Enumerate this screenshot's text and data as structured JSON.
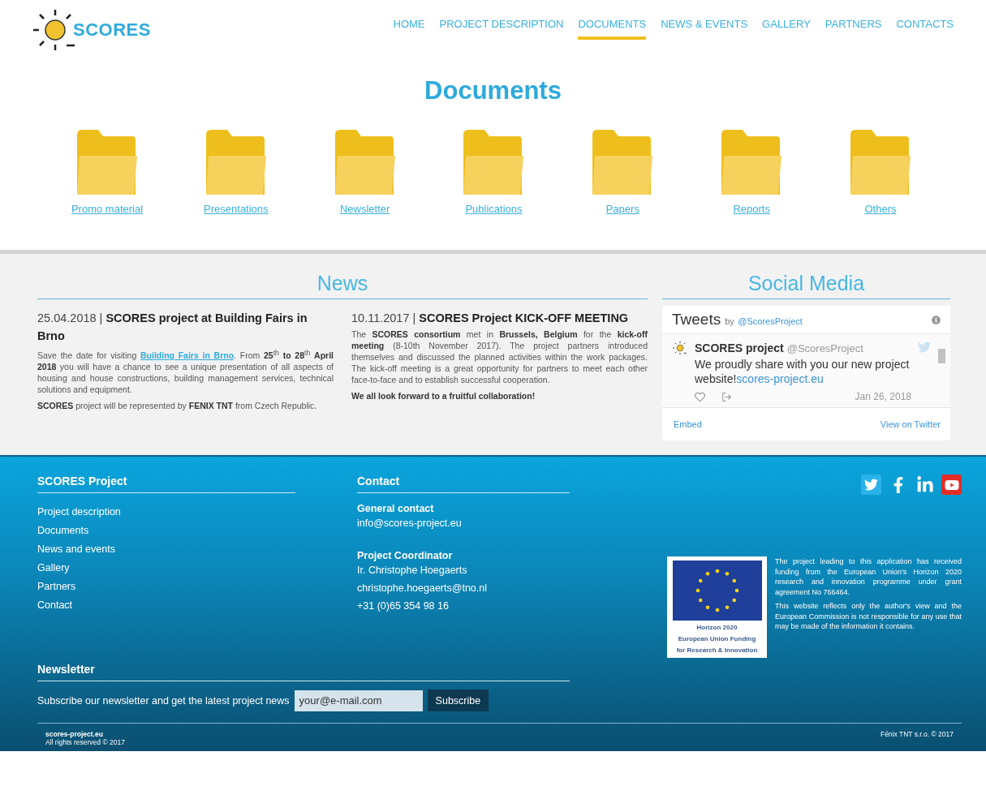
{
  "header": {
    "logo_text": "SCORES",
    "nav": [
      {
        "label": "HOME",
        "selected": false
      },
      {
        "label": "PROJECT DESCRIPTION",
        "selected": false
      },
      {
        "label": "DOCUMENTS",
        "selected": true
      },
      {
        "label": "NEWS & EVENTS",
        "selected": false
      },
      {
        "label": "GALLERY",
        "selected": false
      },
      {
        "label": "PARTNERS",
        "selected": false
      },
      {
        "label": "CONTACTS",
        "selected": false
      }
    ]
  },
  "documents": {
    "title": "Documents",
    "folders": [
      "Promo material",
      "Presentations",
      "Newsletter",
      "Publications",
      "Papers",
      "Reports",
      "Others"
    ]
  },
  "news": {
    "title": "News",
    "items": [
      {
        "heading": "25.04.2018 | **SCORES project at Building Fairs in Brno**",
        "paragraphs": [
          {
            "before": "Save the date for visiting ",
            "link": "Building Fairs in Brno",
            "after": ". From **25**$^{th}$ **to 28**$^{th}$ **April 2018** you will have a chance to see a unique presentation of all aspects of housing and house constructions, building management services, technical solutions and equipment."
          },
          {
            "before": "**SCORES** project will be represented by **FENIX TNT** from Czech Republic."
          }
        ]
      },
      {
        "heading": "10.11.2017 | **SCORES Project KICK-OFF MEETING**",
        "paragraphs": [
          {
            "before": "The **SCORES consortium** met in **Brussels, Belgium** for the **kick-off meeting** (8-10th November 2017). The project partners introduced themselves and discussed the planned activities within the work packages. The kick-off meeting is a great opportunity for partners to meet each other face-to-face and to establish successful cooperation."
          },
          {
            "before": "**We all look forward to a fruitful collaboration!**"
          }
        ]
      }
    ]
  },
  "social": {
    "title": "Social Media",
    "widget": {
      "title": "Tweets",
      "by": "by",
      "handle_link": "@ScoresProject",
      "tweet": {
        "name": "SCORES project",
        "handle": "@ScoresProject",
        "text": "We proudly share with you our new project website!",
        "link": "scores-project.eu",
        "date": "Jan 26, 2018"
      },
      "embed": "Embed",
      "view": "View on Twitter"
    }
  },
  "footer": {
    "project": {
      "title": "SCORES Project",
      "links": [
        "Project description",
        "Documents",
        "News and events",
        "Gallery",
        "Partners",
        "Contact"
      ]
    },
    "contact": {
      "title": "Contact",
      "groups": [
        {
          "label": "General contact",
          "lines": [
            "info@scores-project.eu"
          ]
        },
        {
          "label": "Project Coordinator",
          "lines": [
            "Ir. Christophe Hoegaerts",
            "christophe.hoegaerts@tno.nl",
            "+31 (0)65 354 98 16"
          ]
        }
      ]
    },
    "eu": {
      "caption": [
        "Horizon 2020",
        "European Union Funding",
        "for Research & Innovation"
      ],
      "paragraphs": [
        "The project leading to this application has received funding from the European Union's Horizon 2020 research and innovation programme under grant agreement No 766464.",
        "This website reflects only the author's view and the European Commission is not responsible for any use that may be made of the information it contains."
      ]
    },
    "newsletter": {
      "title": "Newsletter",
      "text": "Subscribe our newsletter and get the latest project news",
      "placeholder": "your@e-mail.com",
      "button": "Subscribe"
    },
    "bottom": {
      "site": "scores-project.eu",
      "rights": "All rights reserved © 2017",
      "company": "Fénix TNT s.r.o. © 2017"
    }
  }
}
